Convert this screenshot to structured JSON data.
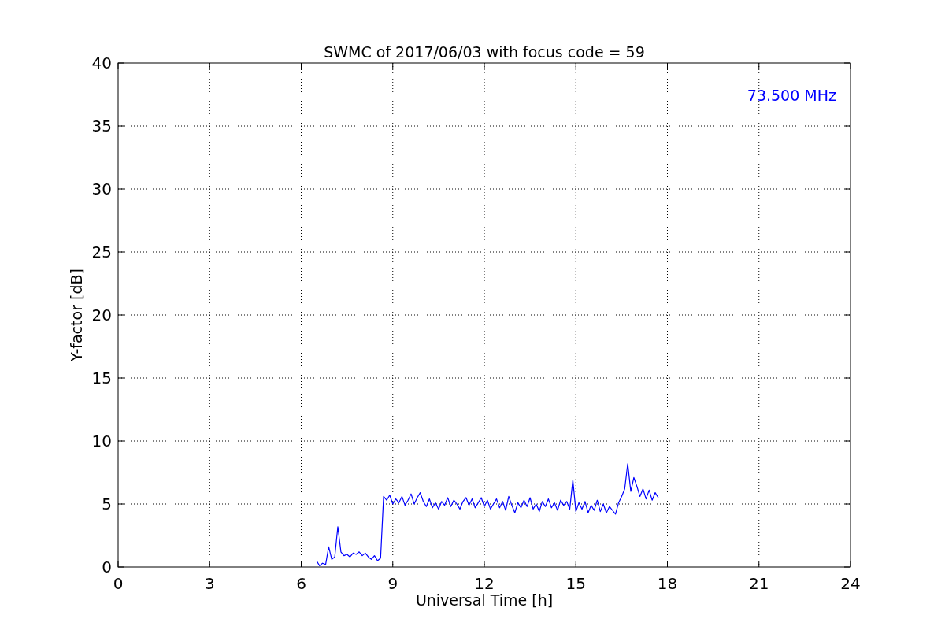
{
  "chart_data": {
    "type": "line",
    "title": "SWMC of 2017/06/03 with focus code = 59",
    "xlabel": "Universal Time [h]",
    "ylabel": "Y-factor [dB]",
    "xlim": [
      0,
      24
    ],
    "ylim": [
      0,
      40
    ],
    "xticks": [
      0,
      3,
      6,
      9,
      12,
      15,
      18,
      21,
      24
    ],
    "yticks": [
      0,
      5,
      10,
      15,
      20,
      25,
      30,
      35,
      40
    ],
    "x": [
      6.5,
      6.6,
      6.7,
      6.8,
      6.9,
      7.0,
      7.1,
      7.2,
      7.3,
      7.4,
      7.5,
      7.6,
      7.7,
      7.8,
      7.9,
      8.0,
      8.1,
      8.2,
      8.3,
      8.4,
      8.5,
      8.6,
      8.7,
      8.8,
      8.9,
      9.0,
      9.1,
      9.2,
      9.3,
      9.4,
      9.5,
      9.6,
      9.7,
      9.8,
      9.9,
      10.0,
      10.1,
      10.2,
      10.3,
      10.4,
      10.5,
      10.6,
      10.7,
      10.8,
      10.9,
      11.0,
      11.1,
      11.2,
      11.3,
      11.4,
      11.5,
      11.6,
      11.7,
      11.8,
      11.9,
      12.0,
      12.1,
      12.2,
      12.3,
      12.4,
      12.5,
      12.6,
      12.7,
      12.8,
      12.9,
      13.0,
      13.1,
      13.2,
      13.3,
      13.4,
      13.5,
      13.6,
      13.7,
      13.8,
      13.9,
      14.0,
      14.1,
      14.2,
      14.3,
      14.4,
      14.5,
      14.6,
      14.7,
      14.8,
      14.9,
      15.0,
      15.1,
      15.2,
      15.3,
      15.4,
      15.5,
      15.6,
      15.7,
      15.8,
      15.9,
      16.0,
      16.1,
      16.2,
      16.3,
      16.4,
      16.5,
      16.6,
      16.7,
      16.8,
      16.9,
      17.0,
      17.1,
      17.2,
      17.3,
      17.4,
      17.5,
      17.6,
      17.7
    ],
    "series": [
      {
        "name": "73.500 MHz",
        "color": "#0000ff",
        "values": [
          0.5,
          0.1,
          0.3,
          0.2,
          1.6,
          0.6,
          0.8,
          3.2,
          1.2,
          0.9,
          1.0,
          0.8,
          1.1,
          1.0,
          1.2,
          0.9,
          1.1,
          0.8,
          0.6,
          0.9,
          0.5,
          0.7,
          5.6,
          5.3,
          5.7,
          5.0,
          5.4,
          5.1,
          5.6,
          4.9,
          5.3,
          5.8,
          5.0,
          5.5,
          5.9,
          5.2,
          4.8,
          5.4,
          4.7,
          5.1,
          4.6,
          5.2,
          4.9,
          5.5,
          4.8,
          5.3,
          5.0,
          4.6,
          5.2,
          5.5,
          4.9,
          5.4,
          4.7,
          5.1,
          5.5,
          4.8,
          5.3,
          4.6,
          5.0,
          5.4,
          4.7,
          5.2,
          4.5,
          5.6,
          4.9,
          4.3,
          5.1,
          4.7,
          5.3,
          4.8,
          5.5,
          4.6,
          5.0,
          4.4,
          5.2,
          4.8,
          5.4,
          4.7,
          5.1,
          4.5,
          5.3,
          4.9,
          5.2,
          4.6,
          6.9,
          4.4,
          5.1,
          4.6,
          5.2,
          4.3,
          4.9,
          4.5,
          5.3,
          4.4,
          5.0,
          4.3,
          4.8,
          4.5,
          4.2,
          5.1,
          5.6,
          6.2,
          8.2,
          6.0,
          7.1,
          6.4,
          5.6,
          6.2,
          5.4,
          6.1,
          5.3,
          5.9,
          5.5
        ]
      }
    ],
    "grid": true
  }
}
